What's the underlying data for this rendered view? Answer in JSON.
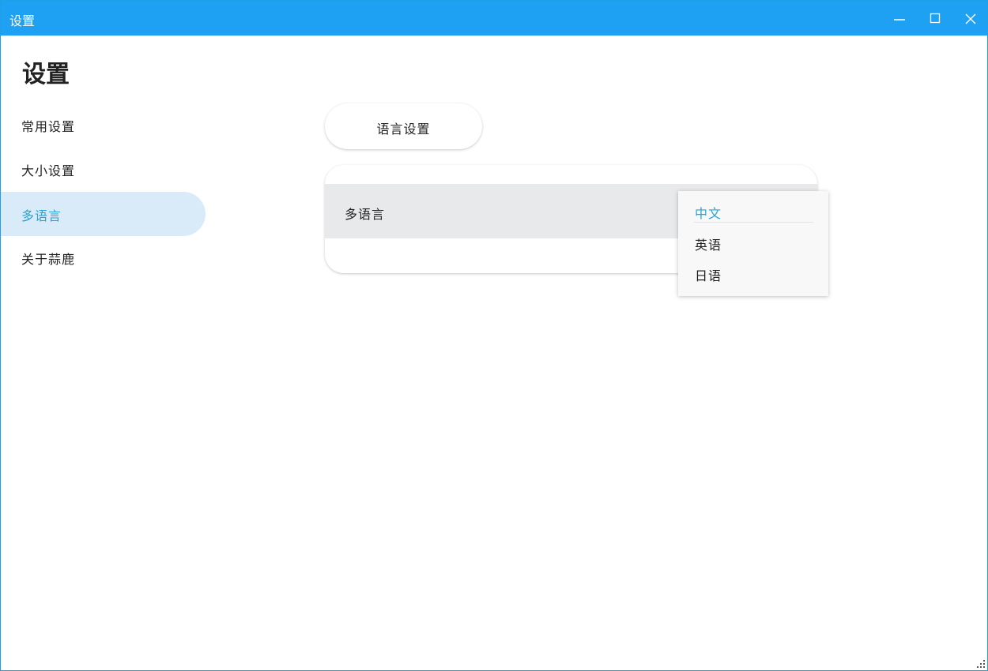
{
  "window": {
    "title": "设置",
    "accent_color": "#1ea1f2",
    "controls": [
      "minimize-icon",
      "maximize-icon",
      "close-icon"
    ]
  },
  "page": {
    "title": "设置"
  },
  "sidebar": {
    "items": [
      {
        "label": "常用设置",
        "active": false
      },
      {
        "label": "大小设置",
        "active": false
      },
      {
        "label": "多语言",
        "active": true
      },
      {
        "label": "关于蒜鹿",
        "active": false
      }
    ],
    "active_color": "#28a3d4",
    "active_bg": "#d9ebf8"
  },
  "main": {
    "section_title": "语言设置",
    "row_label": "多语言",
    "language_dropdown": {
      "selected": "中文",
      "options": [
        "中文",
        "英语",
        "日语"
      ]
    }
  }
}
